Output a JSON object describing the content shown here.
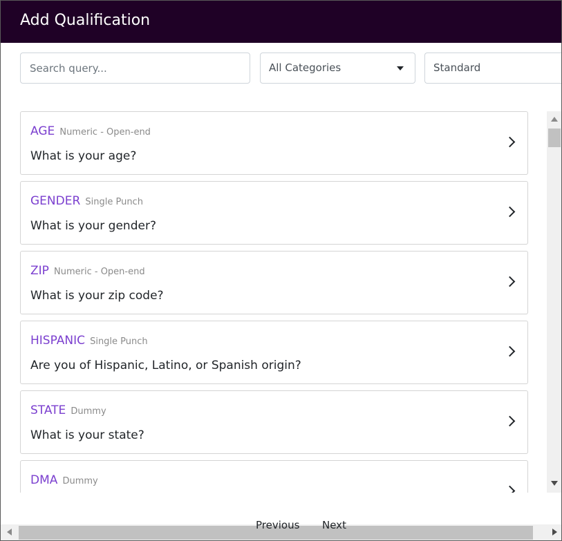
{
  "header": {
    "title": "Add Qualification"
  },
  "filters": {
    "search_placeholder": "Search query...",
    "category_selected": "All Categories",
    "type_selected": "Standard"
  },
  "qualifications": [
    {
      "code": "AGE",
      "type": "Numeric - Open-end",
      "question": "What is your age?"
    },
    {
      "code": "GENDER",
      "type": "Single Punch",
      "question": "What is your gender?"
    },
    {
      "code": "ZIP",
      "type": "Numeric - Open-end",
      "question": "What is your zip code?"
    },
    {
      "code": "HISPANIC",
      "type": "Single Punch",
      "question": "Are you of Hispanic, Latino, or Spanish origin?"
    },
    {
      "code": "STATE",
      "type": "Dummy",
      "question": "What is your state?"
    },
    {
      "code": "DMA",
      "type": "Dummy",
      "question": ""
    }
  ],
  "pager": {
    "previous_label": "Previous",
    "next_label": "Next"
  },
  "icons": {
    "dropdown": "caret-down-icon",
    "row_action": "chevron-right-icon"
  },
  "colors": {
    "header_bg": "#1f0126",
    "code_accent": "#7b3fcf",
    "type_muted": "#8a8a8a"
  }
}
